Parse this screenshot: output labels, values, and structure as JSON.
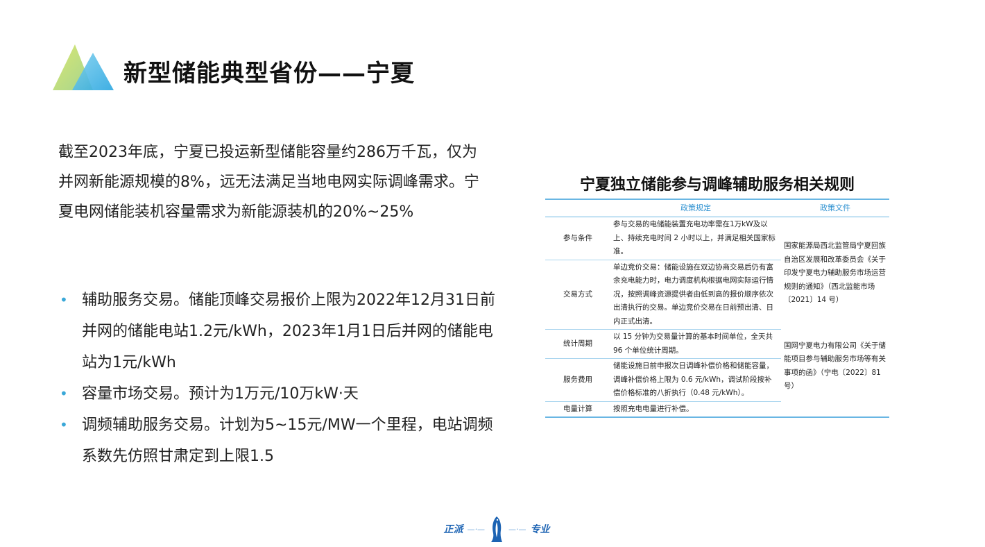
{
  "header": {
    "title": "新型储能典型省份——宁夏"
  },
  "intro": {
    "text": "截至2023年底，宁夏已投运新型储能容量约286万千瓦，仅为并网新能源规模的8%，远无法满足当地电网实际调峰需求。宁夏电网储能装机容量需求为新能源装机的20%~25%"
  },
  "bullets": [
    "辅助服务交易。储能顶峰交易报价上限为2022年12月31日前并网的储能电站1.2元/kWh，2023年1月1日后并网的储能电站为1元/kWh",
    "容量市场交易。预计为1万元/10万kW·天",
    "调频辅助服务交易。计划为5~15元/MW一个里程，电站调频系数先仿照甘肃定到上限1.5"
  ],
  "table": {
    "title": "宁夏独立储能参与调峰辅助服务相关规则",
    "headers": [
      "",
      "政策规定",
      "政策文件"
    ],
    "rows": [
      {
        "category": "参与条件",
        "rule": "参与交易的电储能装置充电功率需在1万kW及以上、持续充电时间 2 小时以上，并满足相关国家标准。"
      },
      {
        "category": "交易方式",
        "rule": "单边竞价交易：储能设施在双边协商交易后仍有富余充电能力时，电力调度机构根据电网实际运行情况，按照调峰资源提供者由低到高的报价顺序依次出清执行的交易。单边竞价交易在日前预出清、日内正式出清。"
      },
      {
        "category": "统计周期",
        "rule": "以 15 分钟为交易量计算的基本时间单位，全天共 96 个单位统计周期。"
      },
      {
        "category": "服务费用",
        "rule": "储能设施日前申报次日调峰补偿价格和储能容量，调峰补偿价格上限为 0.6 元/kWh，调试阶段按补偿价格标准的八折执行（0.48 元/kWh）。"
      },
      {
        "category": "电量计算",
        "rule": "按照充电电量进行补偿。"
      }
    ],
    "documents": [
      "国家能源局西北监管局宁夏回族自治区发展和改革委员会《关于印发宁夏电力辅助服务市场运营规则的通知》（西北监能市场〔2021〕14 号）",
      "国网宁夏电力有限公司《关于储能项目参与辅助服务市场等有关事项的函》（宁电〔2022〕81 号）"
    ]
  },
  "footer": {
    "left": "正派",
    "right": "专业",
    "icon": "penguin-mascot-icon"
  },
  "colors": {
    "accent_blue": "#3aa8d8",
    "table_header": "#2a8fd0",
    "logo_green": "#c4d84a",
    "logo_cyan": "#39b4e4",
    "brand_blue": "#1c63b3"
  }
}
